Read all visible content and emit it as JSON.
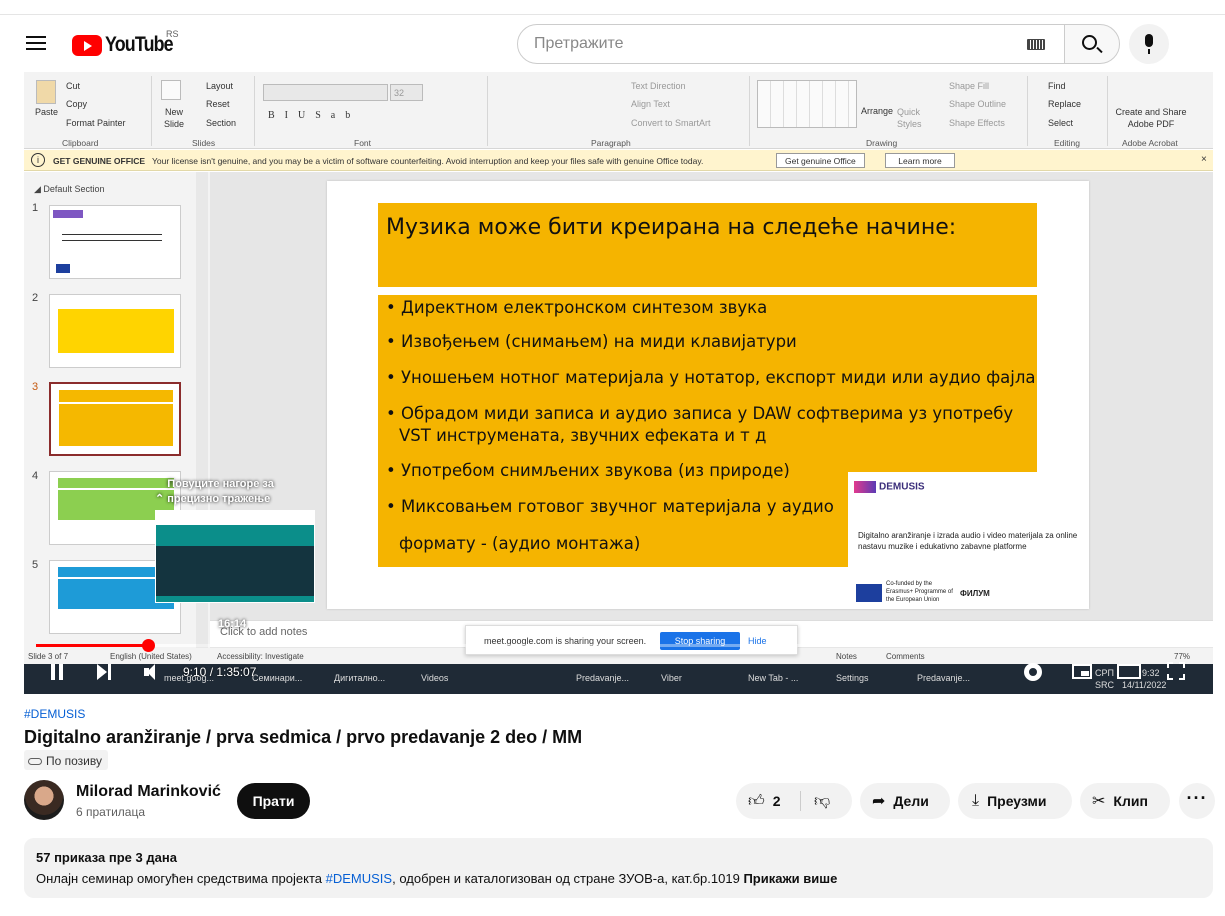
{
  "masthead": {
    "logo_text": "YouTube",
    "region": "RS",
    "search_placeholder": "Претражите"
  },
  "ppt": {
    "clipboard": {
      "paste": "Paste",
      "cut": "Cut",
      "copy": "Copy",
      "format_painter": "Format Painter",
      "group": "Clipboard"
    },
    "slides": {
      "new_slide": "New Slide",
      "layout": "Layout",
      "reset": "Reset",
      "section": "Section",
      "group": "Slides"
    },
    "font": {
      "group": "Font",
      "size": "32"
    },
    "paragraph": {
      "group": "Paragraph",
      "text_direction": "Text Direction",
      "align_text": "Align Text",
      "smartart": "Convert to SmartArt"
    },
    "drawing": {
      "group": "Drawing",
      "arrange": "Arrange",
      "quick_styles": "Quick Styles",
      "fill": "Shape Fill",
      "outline": "Shape Outline",
      "effects": "Shape Effects"
    },
    "editing": {
      "group": "Editing",
      "find": "Find",
      "replace": "Replace",
      "select": "Select"
    },
    "acrobat": {
      "group": "Adobe Acrobat",
      "create": "Create and Share Adobe PDF"
    },
    "genuine": {
      "title": "GET GENUINE OFFICE",
      "message": "Your license isn't genuine, and you may be a victim of software counterfeiting. Avoid interruption and keep your files safe with genuine Office today.",
      "btn_get": "Get genuine Office",
      "btn_learn": "Learn more"
    },
    "section_name": "Default Section",
    "slide_numbers": [
      "1",
      "2",
      "3",
      "4",
      "5"
    ],
    "slide": {
      "title": "Музика може бити креирана на следеће начине:",
      "bullets": [
        "Директном електронском синтезом звука",
        "Извођењем (снимањем) на миди клавијатури",
        "Уношењем нотног материјала у нотатор, експорт миди или аудио фајла",
        "Обрадом миди записа и аудио записа у DAW софтверима уз употребу",
        "VST инструмената, звучних ефеката и т д",
        "Употребом снимљених звукова (из природе)",
        "Миксовањем готовог звучног материјала у аудио",
        "формату - (аудио монтажа)"
      ],
      "logo_word": "DEMUSIS",
      "logo_caption": "Digitalno aranžiranje i izrada audio i video materijala za online nastavu muzike i edukativno zabavne platforme",
      "cofunded": "Co-funded by the Erasmus+ Programme of the European Union",
      "filum": "ФИЛУМ"
    },
    "notes_placeholder": "Click to add notes",
    "status": {
      "slide": "Slide 3 of 7",
      "language": "English (United States)",
      "accessibility": "Accessibility: Investigate",
      "notes": "Notes",
      "comments": "Comments",
      "zoom": "77%"
    },
    "meet": {
      "message": "meet.google.com is sharing your screen.",
      "stop": "Stop sharing",
      "hide": "Hide"
    },
    "taskbar": [
      "meet.goog...",
      "Семинари...",
      "Дигитално...",
      "Videos",
      "Predavanje...",
      "Viber",
      "New Tab - ...",
      "Settings",
      "Predavanje..."
    ],
    "tray": {
      "lang": "СРП",
      "lang2": "SRC",
      "time": "9:32",
      "date": "14/11/2022"
    }
  },
  "player": {
    "tooltip": "Повуците нагоре за прецизно тражење",
    "preview_time": "16:14",
    "time": "9:10 / 1:35:07",
    "progress": 0.096
  },
  "video": {
    "hashtag": "#DEMUSIS",
    "title": "Digitalno aranžiranje / prva sedmica / prvo predavanje 2 deo / MM",
    "visibility": "По позиву",
    "channel": "Milorad Marinković",
    "subscribers": "6 пратилаца",
    "subscribe": "Прати",
    "likes": "2",
    "share": "Дели",
    "download": "Преузми",
    "clip": "Клип",
    "views_date": "57 приказа  пре 3 дана",
    "desc_prefix": "Онлајн семинар омогућен средствима пројекта ",
    "desc_link": "#DEMUSIS",
    "desc_suffix": ", одобрен и каталогизован од стране ЗУОВ-а, кат.бр.1019 ",
    "show_more": "Прикажи више"
  }
}
